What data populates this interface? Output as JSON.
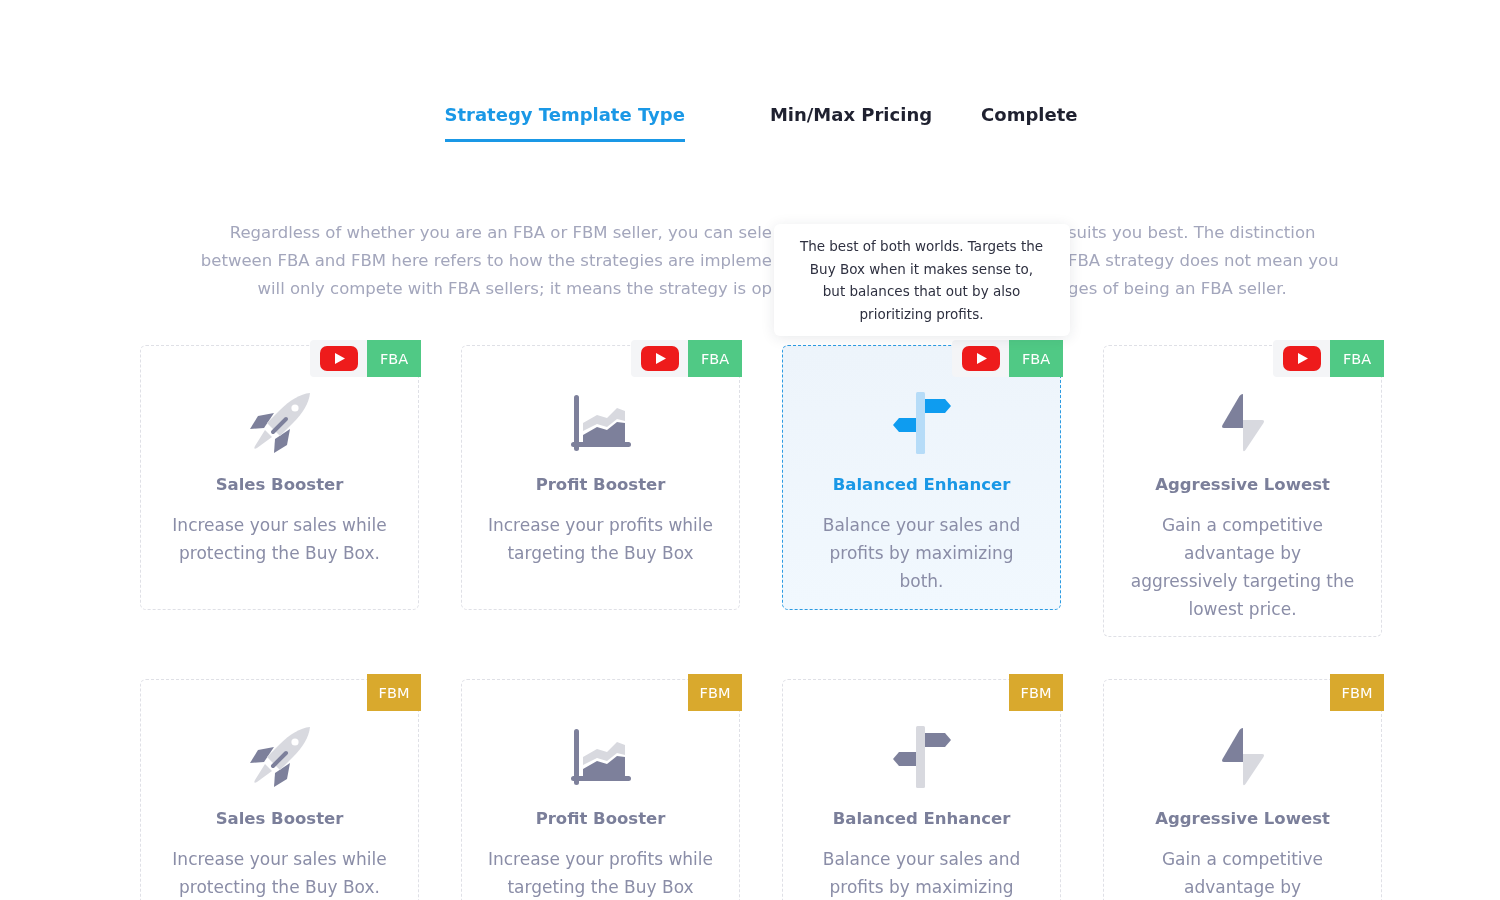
{
  "tabs": [
    {
      "label": "Strategy Template Type",
      "selected": true
    },
    {
      "label": "Min/Max Pricing",
      "selected": false
    },
    {
      "label": "Complete",
      "selected": false
    }
  ],
  "intro": [
    {
      "left": "Regardless of whether you are an FBA or FBM seller, you can sele",
      "right": "suits you best. The distinction"
    },
    {
      "left": "between FBA and FBM here refers to how the strategies are impleme",
      "right": "FBA strategy does not mean you"
    },
    {
      "left": "will only compete with FBA sellers; it means the strategy is op",
      "right": "ges of being an FBA seller."
    }
  ],
  "strategies": [
    {
      "kind": "rocket",
      "title": "Sales Booster",
      "description": "Increase your sales while protecting the Buy Box.",
      "badge": {
        "label": "FBA",
        "color": "#50c985"
      },
      "video": true,
      "selected": false
    },
    {
      "kind": "chart",
      "title": "Profit Booster",
      "description": "Increase your profits while targeting the Buy Box",
      "badge": {
        "label": "FBA",
        "color": "#50c985"
      },
      "video": true,
      "selected": false
    },
    {
      "kind": "signpost",
      "title": "Balanced Enhancer",
      "description": "Balance your sales and profits by maximizing both.",
      "badge": {
        "label": "FBA",
        "color": "#50c985"
      },
      "video": true,
      "selected": true,
      "tooltip": "The best of both worlds. Targets the Buy Box when it makes sense to, but balances that out by also prioritizing profits."
    },
    {
      "kind": "bolt",
      "title": "Aggressive Lowest",
      "description": "Gain a competitive advantage by aggressively targeting the lowest price.",
      "badge": {
        "label": "FBA",
        "color": "#50c985"
      },
      "video": true,
      "selected": false
    },
    {
      "kind": "rocket",
      "title": "Sales Booster",
      "description": "Increase your sales while protecting the Buy Box.",
      "badge": {
        "label": "FBM",
        "color": "#d9a92d"
      },
      "video": false,
      "selected": false
    },
    {
      "kind": "chart",
      "title": "Profit Booster",
      "description": "Increase your profits while targeting the Buy Box",
      "badge": {
        "label": "FBM",
        "color": "#d9a92d"
      },
      "video": false,
      "selected": false
    },
    {
      "kind": "signpost",
      "title": "Balanced Enhancer",
      "description": "Balance your sales and profits by maximizing",
      "badge": {
        "label": "FBM",
        "color": "#d9a92d"
      },
      "video": false,
      "selected": false
    },
    {
      "kind": "bolt",
      "title": "Aggressive Lowest",
      "description": "Gain a competitive advantage by",
      "badge": {
        "label": "FBM",
        "color": "#d9a92d"
      },
      "video": false,
      "selected": false
    }
  ]
}
